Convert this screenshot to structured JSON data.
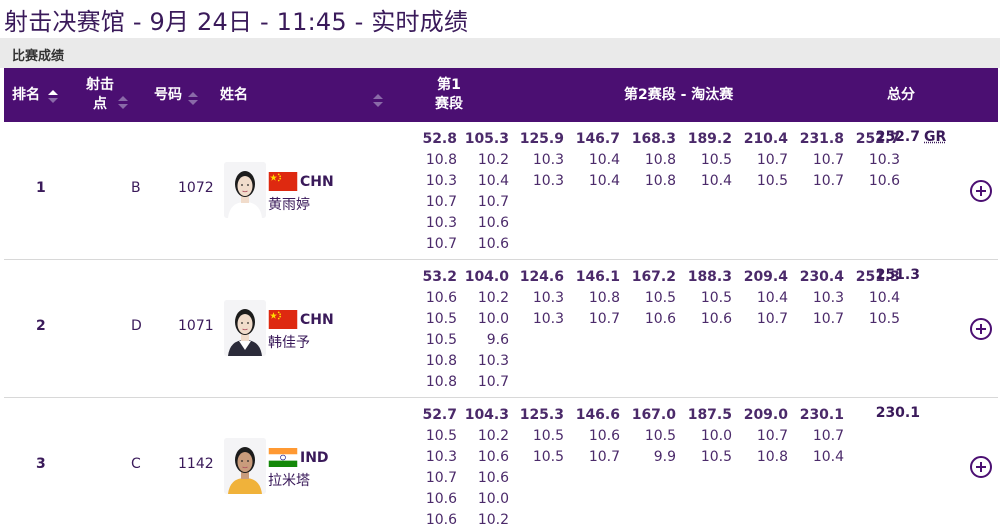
{
  "page": {
    "title": "射击决赛馆 - 9月 24日 - 11:45 - 实时成绩",
    "section_label": "比赛成绩"
  },
  "header": {
    "rank": "排名",
    "lane_line1": "射击",
    "lane_line2": "点",
    "bib": "号码",
    "name": "姓名",
    "stage1_line1": "第1",
    "stage1_line2": "赛段",
    "stage2": "第2赛段 - 淘汰赛",
    "total": "总分"
  },
  "colors": {
    "header_bg": "#4b0f72",
    "accent": "#3a1a5a",
    "china_flag": "#de2910",
    "india_saffron": "#ff9933",
    "india_green": "#138808"
  },
  "rows": [
    {
      "rank": "1",
      "lane": "B",
      "bib": "1072",
      "noc": "CHN",
      "name": "黄雨婷",
      "flag": "china-flag",
      "stage1_subtotals": [
        "52.8",
        "105.3"
      ],
      "stage1_shots": [
        [
          "10.8",
          "10.2"
        ],
        [
          "10.3",
          "10.4"
        ],
        [
          "10.7",
          "10.7"
        ],
        [
          "10.3",
          "10.6"
        ],
        [
          "10.7",
          "10.6"
        ]
      ],
      "stage2_subtotals": [
        "125.9",
        "146.7",
        "168.3",
        "189.2",
        "210.4",
        "231.8",
        "252.7"
      ],
      "stage2_shots": [
        [
          "10.3",
          "10.3"
        ],
        [
          "10.4",
          "10.4"
        ],
        [
          "10.8",
          "10.8"
        ],
        [
          "10.5",
          "10.4"
        ],
        [
          "10.7",
          "10.5"
        ],
        [
          "10.7",
          "10.7"
        ],
        [
          "10.3",
          "10.6"
        ]
      ],
      "total": "252.7",
      "record": "GR"
    },
    {
      "rank": "2",
      "lane": "D",
      "bib": "1071",
      "noc": "CHN",
      "name": "韩佳予",
      "flag": "china-flag",
      "stage1_subtotals": [
        "53.2",
        "104.0"
      ],
      "stage1_shots": [
        [
          "10.6",
          "10.2"
        ],
        [
          "10.5",
          "10.0"
        ],
        [
          "10.5",
          "9.6"
        ],
        [
          "10.8",
          "10.3"
        ],
        [
          "10.8",
          "10.7"
        ]
      ],
      "stage2_subtotals": [
        "124.6",
        "146.1",
        "167.2",
        "188.3",
        "209.4",
        "230.4",
        "251.3"
      ],
      "stage2_shots": [
        [
          "10.3",
          "10.3"
        ],
        [
          "10.8",
          "10.7"
        ],
        [
          "10.5",
          "10.6"
        ],
        [
          "10.5",
          "10.6"
        ],
        [
          "10.4",
          "10.7"
        ],
        [
          "10.3",
          "10.7"
        ],
        [
          "10.4",
          "10.5"
        ]
      ],
      "total": "251.3",
      "record": ""
    },
    {
      "rank": "3",
      "lane": "C",
      "bib": "1142",
      "noc": "IND",
      "name": "拉米塔",
      "flag": "india-flag",
      "stage1_subtotals": [
        "52.7",
        "104.3"
      ],
      "stage1_shots": [
        [
          "10.5",
          "10.2"
        ],
        [
          "10.3",
          "10.6"
        ],
        [
          "10.7",
          "10.6"
        ],
        [
          "10.6",
          "10.0"
        ],
        [
          "10.6",
          "10.2"
        ]
      ],
      "stage2_subtotals": [
        "125.3",
        "146.6",
        "167.0",
        "187.5",
        "209.0",
        "230.1"
      ],
      "stage2_shots": [
        [
          "10.5",
          "10.5"
        ],
        [
          "10.6",
          "10.7"
        ],
        [
          "10.5",
          "9.9"
        ],
        [
          "10.0",
          "10.5"
        ],
        [
          "10.7",
          "10.8"
        ],
        [
          "10.7",
          "10.4"
        ]
      ],
      "total": "230.1",
      "record": ""
    }
  ]
}
